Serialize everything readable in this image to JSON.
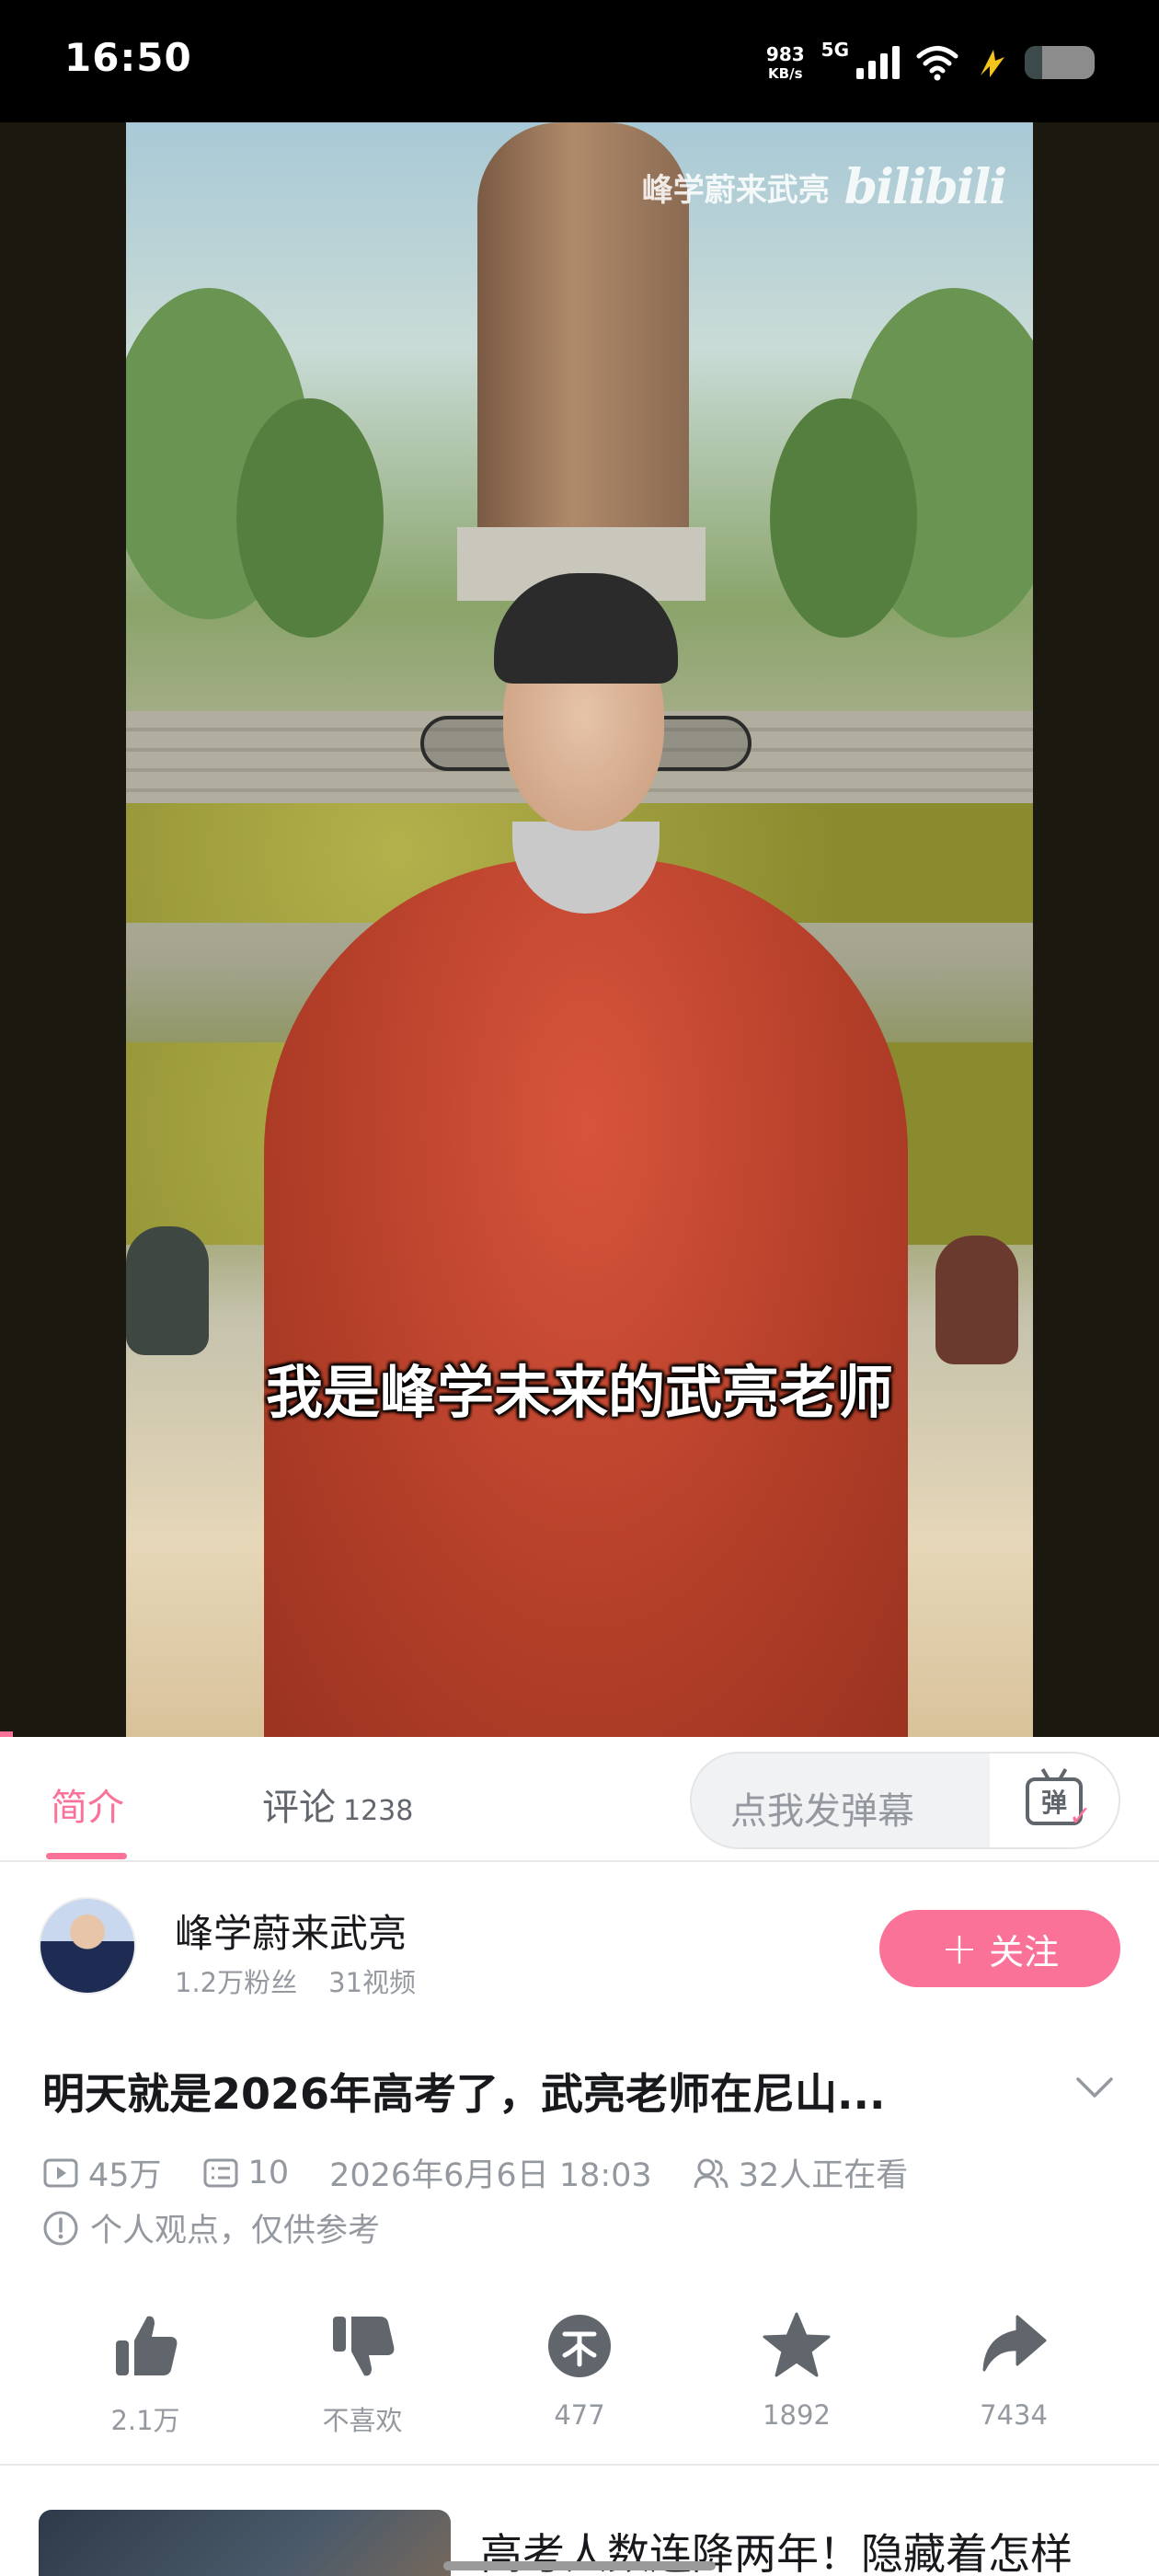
{
  "status_bar": {
    "time": "16:50",
    "net_speed_value": "983",
    "net_speed_unit": "KB/s",
    "network_type": "5G",
    "battery_level": 0.25
  },
  "video": {
    "watermark_text": "峰学蔚来武亮",
    "watermark_logo": "bilibili",
    "subtitle": "我是峰学未来的武亮老师"
  },
  "tabs": {
    "intro_label": "简介",
    "comments_label": "评论",
    "comments_count": "1238",
    "danmaku_placeholder": "点我发弹幕",
    "danmaku_icon_text": "弹"
  },
  "uploader": {
    "name": "峰学蔚来武亮",
    "fans": "1.2万粉丝",
    "videos": "31视频",
    "follow_label": "关注"
  },
  "video_info": {
    "title": "明天就是2026年高考了，武亮老师在尼山...",
    "views": "45万",
    "danmaku_count": "10",
    "publish_time": "2026年6月6日 18:03",
    "watching_now": "32人正在看",
    "note": "个人观点，仅供参考"
  },
  "actions": {
    "like": "2.1万",
    "dislike": "不喜欢",
    "coin": "477",
    "favorite": "1892",
    "share": "7434"
  },
  "recommended": {
    "title": "高考人数连降两年！隐藏着怎样"
  },
  "colors": {
    "accent": "#fb7299",
    "text_primary": "#18191c",
    "text_secondary": "#9499a0",
    "icon_gray": "#61666d"
  }
}
